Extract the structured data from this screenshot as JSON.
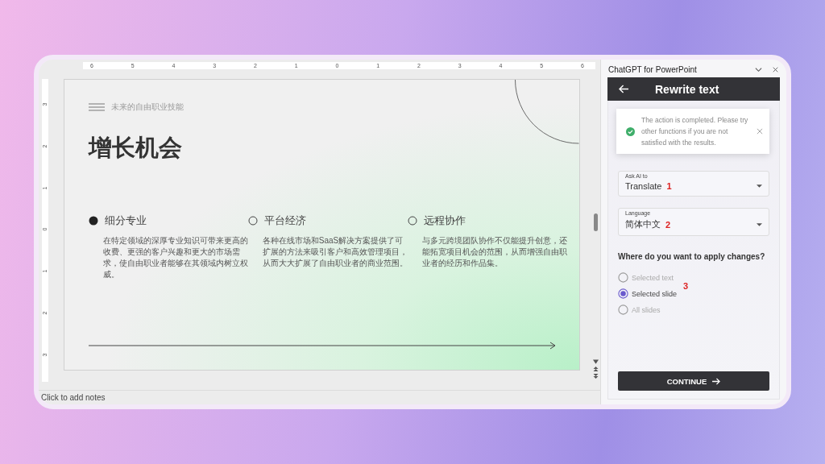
{
  "ruler": {
    "top_ticks": [
      "6",
      "5",
      "4",
      "3",
      "2",
      "1",
      "0",
      "1",
      "2",
      "3",
      "4",
      "5",
      "6"
    ],
    "side_ticks": [
      "3",
      "2",
      "1",
      "0",
      "1",
      "2",
      "3"
    ]
  },
  "slide": {
    "subtitle": "未来的自由职业技能",
    "title": "增长机会",
    "points": [
      {
        "heading": "细分专业",
        "selected": true,
        "text": "在特定领域的深厚专业知识可带来更高的收费、更强的客户兴趣和更大的市场需求，使自由职业者能够在其领域内树立权威。"
      },
      {
        "heading": "平台经济",
        "selected": false,
        "text": "各种在线市场和SaaS解决方案提供了可扩展的方法来吸引客户和高效管理项目，从而大大扩展了自由职业者的商业范围。"
      },
      {
        "heading": "远程协作",
        "selected": false,
        "text": "与多元跨境团队协作不仅能提升创意，还能拓宽项目机会的范围，从而增强自由职业者的经历和作品集。"
      }
    ]
  },
  "notes": {
    "placeholder": "Click to add notes"
  },
  "panel": {
    "title": "ChatGPT for PowerPoint",
    "header": "Rewrite text",
    "toast": "The action is completed. Please try other functions if you are not satisfied with the results.",
    "fields": [
      {
        "label": "Ask AI to",
        "value": "Translate",
        "annotation": "1"
      },
      {
        "label": "Language",
        "value": "简体中文",
        "annotation": "2"
      }
    ],
    "question": "Where do you want to apply changes?",
    "options": [
      {
        "label": "Selected text",
        "selected": false
      },
      {
        "label": "Selected slide",
        "selected": true
      },
      {
        "label": "All slides",
        "selected": false
      }
    ],
    "options_annotation": "3",
    "button": "CONTINUE"
  }
}
